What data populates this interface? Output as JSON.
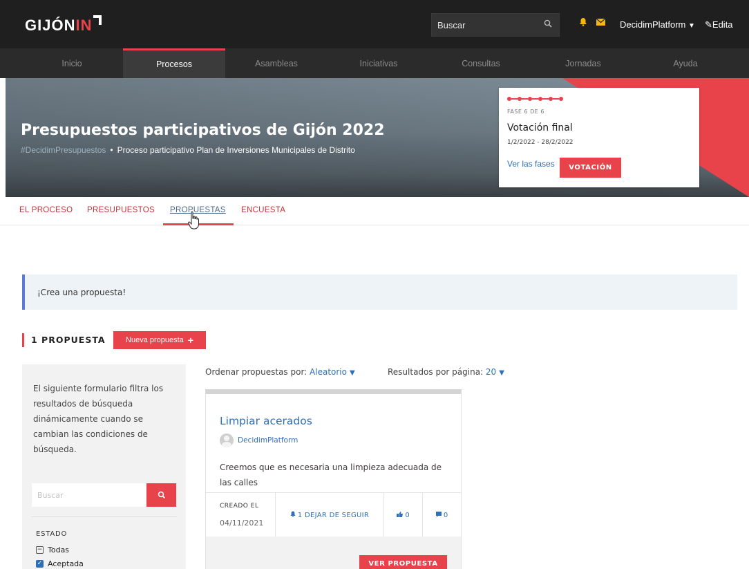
{
  "header": {
    "logo_text": "GIJÓN",
    "logo_accent": "IN",
    "search_placeholder": "Buscar",
    "user_name": "DecidimPlatform",
    "edit_label": "Edita"
  },
  "main_nav": {
    "items": [
      {
        "label": "Inicio"
      },
      {
        "label": "Procesos",
        "active": true
      },
      {
        "label": "Asambleas"
      },
      {
        "label": "Iniciativas"
      },
      {
        "label": "Consultas"
      },
      {
        "label": "Jornadas"
      },
      {
        "label": "Ayuda"
      }
    ]
  },
  "hero": {
    "title": "Presupuestos participativos de Gijón 2022",
    "hashtag": "#DecidimPresupuestos",
    "subtitle": "Proceso participativo Plan de Inversiones Municipales de Distrito"
  },
  "phase": {
    "label": "FASE 6 DE 6",
    "total": 6,
    "current": 6,
    "title": "Votación final",
    "dates": "1/2/2022 - 28/2/2022",
    "link": "Ver las fases",
    "button": "VOTACIÓN"
  },
  "sub_nav": {
    "tabs": [
      {
        "label": "EL PROCESO"
      },
      {
        "label": "PRESUPUESTOS"
      },
      {
        "label": "PROPUESTAS",
        "active": true
      },
      {
        "label": "ENCUESTA"
      }
    ]
  },
  "callout": {
    "text": "¡Crea una propuesta!"
  },
  "listing": {
    "count_label": "1 PROPUESTA",
    "new_button": "Nueva propuesta",
    "sort_label": "Ordenar propuestas por:",
    "sort_value": "Aleatorio",
    "per_page_label": "Resultados por página:",
    "per_page_value": "20"
  },
  "filters": {
    "description": "El siguiente formulario filtra los resultados de búsqueda dinámicamente cuando se cambian las condiciones de búsqueda.",
    "search_placeholder": "Buscar",
    "estado_label": "ESTADO",
    "options": [
      {
        "label": "Todas",
        "state": "indeterminate"
      },
      {
        "label": "Aceptada",
        "state": "checked"
      }
    ]
  },
  "card": {
    "title": "Limpiar acerados",
    "author": "DecidimPlatform",
    "body": "Creemos que es necesaria una limpieza adecuada de las calles",
    "created_label": "CREADO EL",
    "created_date": "04/11/2021",
    "follow_label": "1 DEJAR DE SEGUIR",
    "endorsements": "0",
    "comments": "0",
    "view_button": "VER PROPUESTA"
  },
  "colors": {
    "accent": "#e8424a",
    "link": "#2e6fb8",
    "topbar": "#1f1f1f",
    "nav": "#2b2b2b"
  }
}
